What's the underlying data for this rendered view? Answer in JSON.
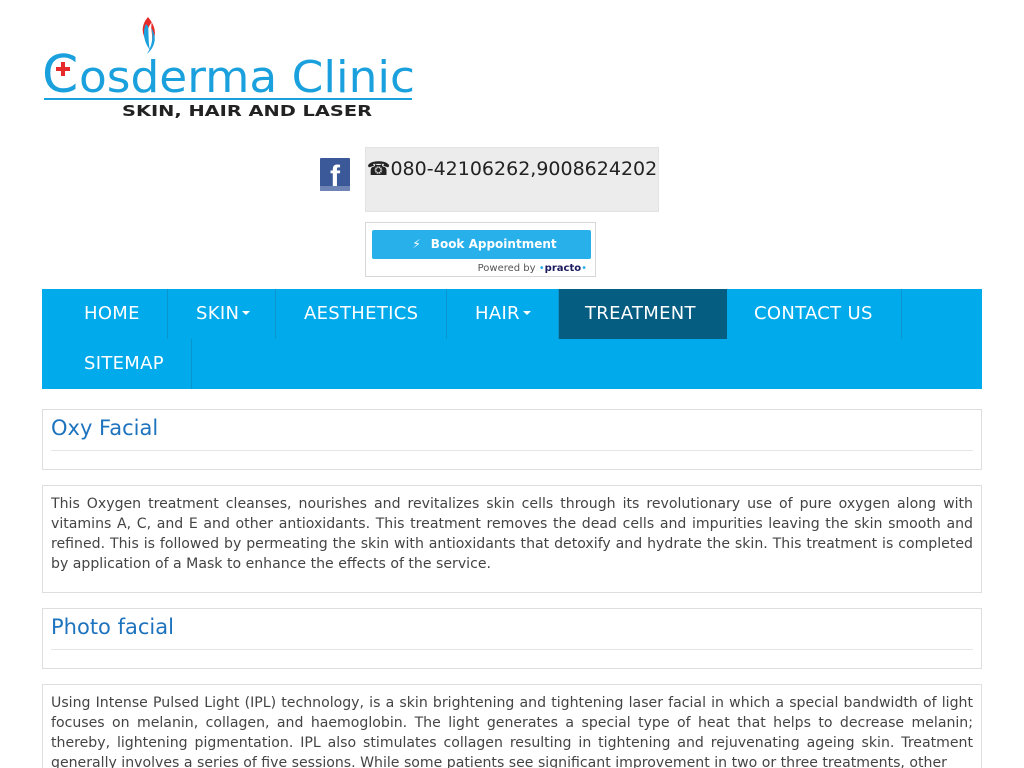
{
  "logo": {
    "brand_prefix": "C",
    "brand_rest": "osderma Clinic",
    "tagline": "SKIN, HAIR AND LASER",
    "colors": {
      "primary": "#1aa1dd",
      "accent": "#e62a2a",
      "dark": "#222222"
    }
  },
  "social": {
    "facebook_letter": "f",
    "icon": "facebook-icon"
  },
  "contact": {
    "phone_icon": "☎",
    "phone_text": "080-42106262,9008624202"
  },
  "practo": {
    "button_label": "Book Appointment",
    "powered_by": "Powered by",
    "brand": "practo",
    "brand_dot": "•",
    "colors": {
      "button": "#28b0eb"
    }
  },
  "nav": {
    "colors": {
      "bar": "#00aaeb",
      "active": "#055d82"
    },
    "items": [
      {
        "label": "HOME"
      },
      {
        "label": "SKIN"
      },
      {
        "label": "AESTHETICS"
      },
      {
        "label": "HAIR"
      },
      {
        "label": "TREATMENT"
      },
      {
        "label": "CONTACT US"
      },
      {
        "label": "SITEMAP"
      }
    ]
  },
  "sections": [
    {
      "title": "Oxy Facial",
      "body": "This Oxygen treatment cleanses, nourishes and revitalizes skin cells through its revolutionary use of pure oxygen along with vitamins A, C, and E and other antioxidants. This treatment removes the dead cells and impurities leaving the skin smooth and refined. This is followed by permeating the skin with antioxidants that detoxify and hydrate the skin. This treatment is completed by application of a Mask to enhance the effects of the service."
    },
    {
      "title": "Photo facial",
      "body": "Using Intense Pulsed Light (IPL) technology, is a skin brightening and tightening laser facial in which a special bandwidth of light focuses on melanin, collagen, and haemoglobin. The light generates a special type of heat that helps to decrease melanin; thereby, lightening pigmentation. IPL also stimulates collagen resulting in tightening and rejuvenating ageing skin. Treatment generally involves a series of five sessions. While some patients see significant improvement in two or three treatments, other"
    }
  ]
}
